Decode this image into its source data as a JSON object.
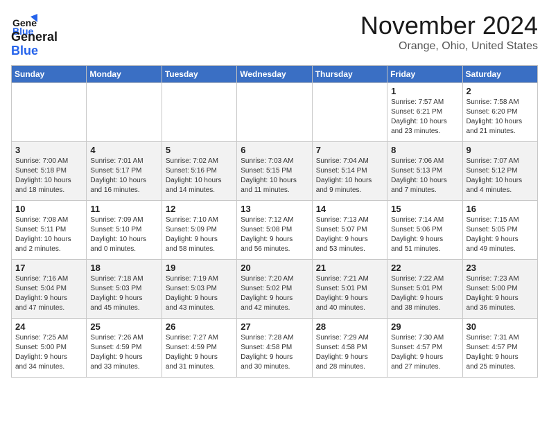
{
  "logo": {
    "text_general": "General",
    "text_blue": "Blue"
  },
  "title": "November 2024",
  "location": "Orange, Ohio, United States",
  "days_of_week": [
    "Sunday",
    "Monday",
    "Tuesday",
    "Wednesday",
    "Thursday",
    "Friday",
    "Saturday"
  ],
  "weeks": [
    [
      {
        "day": "",
        "info": ""
      },
      {
        "day": "",
        "info": ""
      },
      {
        "day": "",
        "info": ""
      },
      {
        "day": "",
        "info": ""
      },
      {
        "day": "",
        "info": ""
      },
      {
        "day": "1",
        "info": "Sunrise: 7:57 AM\nSunset: 6:21 PM\nDaylight: 10 hours\nand 23 minutes."
      },
      {
        "day": "2",
        "info": "Sunrise: 7:58 AM\nSunset: 6:20 PM\nDaylight: 10 hours\nand 21 minutes."
      }
    ],
    [
      {
        "day": "3",
        "info": "Sunrise: 7:00 AM\nSunset: 5:18 PM\nDaylight: 10 hours\nand 18 minutes."
      },
      {
        "day": "4",
        "info": "Sunrise: 7:01 AM\nSunset: 5:17 PM\nDaylight: 10 hours\nand 16 minutes."
      },
      {
        "day": "5",
        "info": "Sunrise: 7:02 AM\nSunset: 5:16 PM\nDaylight: 10 hours\nand 14 minutes."
      },
      {
        "day": "6",
        "info": "Sunrise: 7:03 AM\nSunset: 5:15 PM\nDaylight: 10 hours\nand 11 minutes."
      },
      {
        "day": "7",
        "info": "Sunrise: 7:04 AM\nSunset: 5:14 PM\nDaylight: 10 hours\nand 9 minutes."
      },
      {
        "day": "8",
        "info": "Sunrise: 7:06 AM\nSunset: 5:13 PM\nDaylight: 10 hours\nand 7 minutes."
      },
      {
        "day": "9",
        "info": "Sunrise: 7:07 AM\nSunset: 5:12 PM\nDaylight: 10 hours\nand 4 minutes."
      }
    ],
    [
      {
        "day": "10",
        "info": "Sunrise: 7:08 AM\nSunset: 5:11 PM\nDaylight: 10 hours\nand 2 minutes."
      },
      {
        "day": "11",
        "info": "Sunrise: 7:09 AM\nSunset: 5:10 PM\nDaylight: 10 hours\nand 0 minutes."
      },
      {
        "day": "12",
        "info": "Sunrise: 7:10 AM\nSunset: 5:09 PM\nDaylight: 9 hours\nand 58 minutes."
      },
      {
        "day": "13",
        "info": "Sunrise: 7:12 AM\nSunset: 5:08 PM\nDaylight: 9 hours\nand 56 minutes."
      },
      {
        "day": "14",
        "info": "Sunrise: 7:13 AM\nSunset: 5:07 PM\nDaylight: 9 hours\nand 53 minutes."
      },
      {
        "day": "15",
        "info": "Sunrise: 7:14 AM\nSunset: 5:06 PM\nDaylight: 9 hours\nand 51 minutes."
      },
      {
        "day": "16",
        "info": "Sunrise: 7:15 AM\nSunset: 5:05 PM\nDaylight: 9 hours\nand 49 minutes."
      }
    ],
    [
      {
        "day": "17",
        "info": "Sunrise: 7:16 AM\nSunset: 5:04 PM\nDaylight: 9 hours\nand 47 minutes."
      },
      {
        "day": "18",
        "info": "Sunrise: 7:18 AM\nSunset: 5:03 PM\nDaylight: 9 hours\nand 45 minutes."
      },
      {
        "day": "19",
        "info": "Sunrise: 7:19 AM\nSunset: 5:03 PM\nDaylight: 9 hours\nand 43 minutes."
      },
      {
        "day": "20",
        "info": "Sunrise: 7:20 AM\nSunset: 5:02 PM\nDaylight: 9 hours\nand 42 minutes."
      },
      {
        "day": "21",
        "info": "Sunrise: 7:21 AM\nSunset: 5:01 PM\nDaylight: 9 hours\nand 40 minutes."
      },
      {
        "day": "22",
        "info": "Sunrise: 7:22 AM\nSunset: 5:01 PM\nDaylight: 9 hours\nand 38 minutes."
      },
      {
        "day": "23",
        "info": "Sunrise: 7:23 AM\nSunset: 5:00 PM\nDaylight: 9 hours\nand 36 minutes."
      }
    ],
    [
      {
        "day": "24",
        "info": "Sunrise: 7:25 AM\nSunset: 5:00 PM\nDaylight: 9 hours\nand 34 minutes."
      },
      {
        "day": "25",
        "info": "Sunrise: 7:26 AM\nSunset: 4:59 PM\nDaylight: 9 hours\nand 33 minutes."
      },
      {
        "day": "26",
        "info": "Sunrise: 7:27 AM\nSunset: 4:59 PM\nDaylight: 9 hours\nand 31 minutes."
      },
      {
        "day": "27",
        "info": "Sunrise: 7:28 AM\nSunset: 4:58 PM\nDaylight: 9 hours\nand 30 minutes."
      },
      {
        "day": "28",
        "info": "Sunrise: 7:29 AM\nSunset: 4:58 PM\nDaylight: 9 hours\nand 28 minutes."
      },
      {
        "day": "29",
        "info": "Sunrise: 7:30 AM\nSunset: 4:57 PM\nDaylight: 9 hours\nand 27 minutes."
      },
      {
        "day": "30",
        "info": "Sunrise: 7:31 AM\nSunset: 4:57 PM\nDaylight: 9 hours\nand 25 minutes."
      }
    ]
  ]
}
